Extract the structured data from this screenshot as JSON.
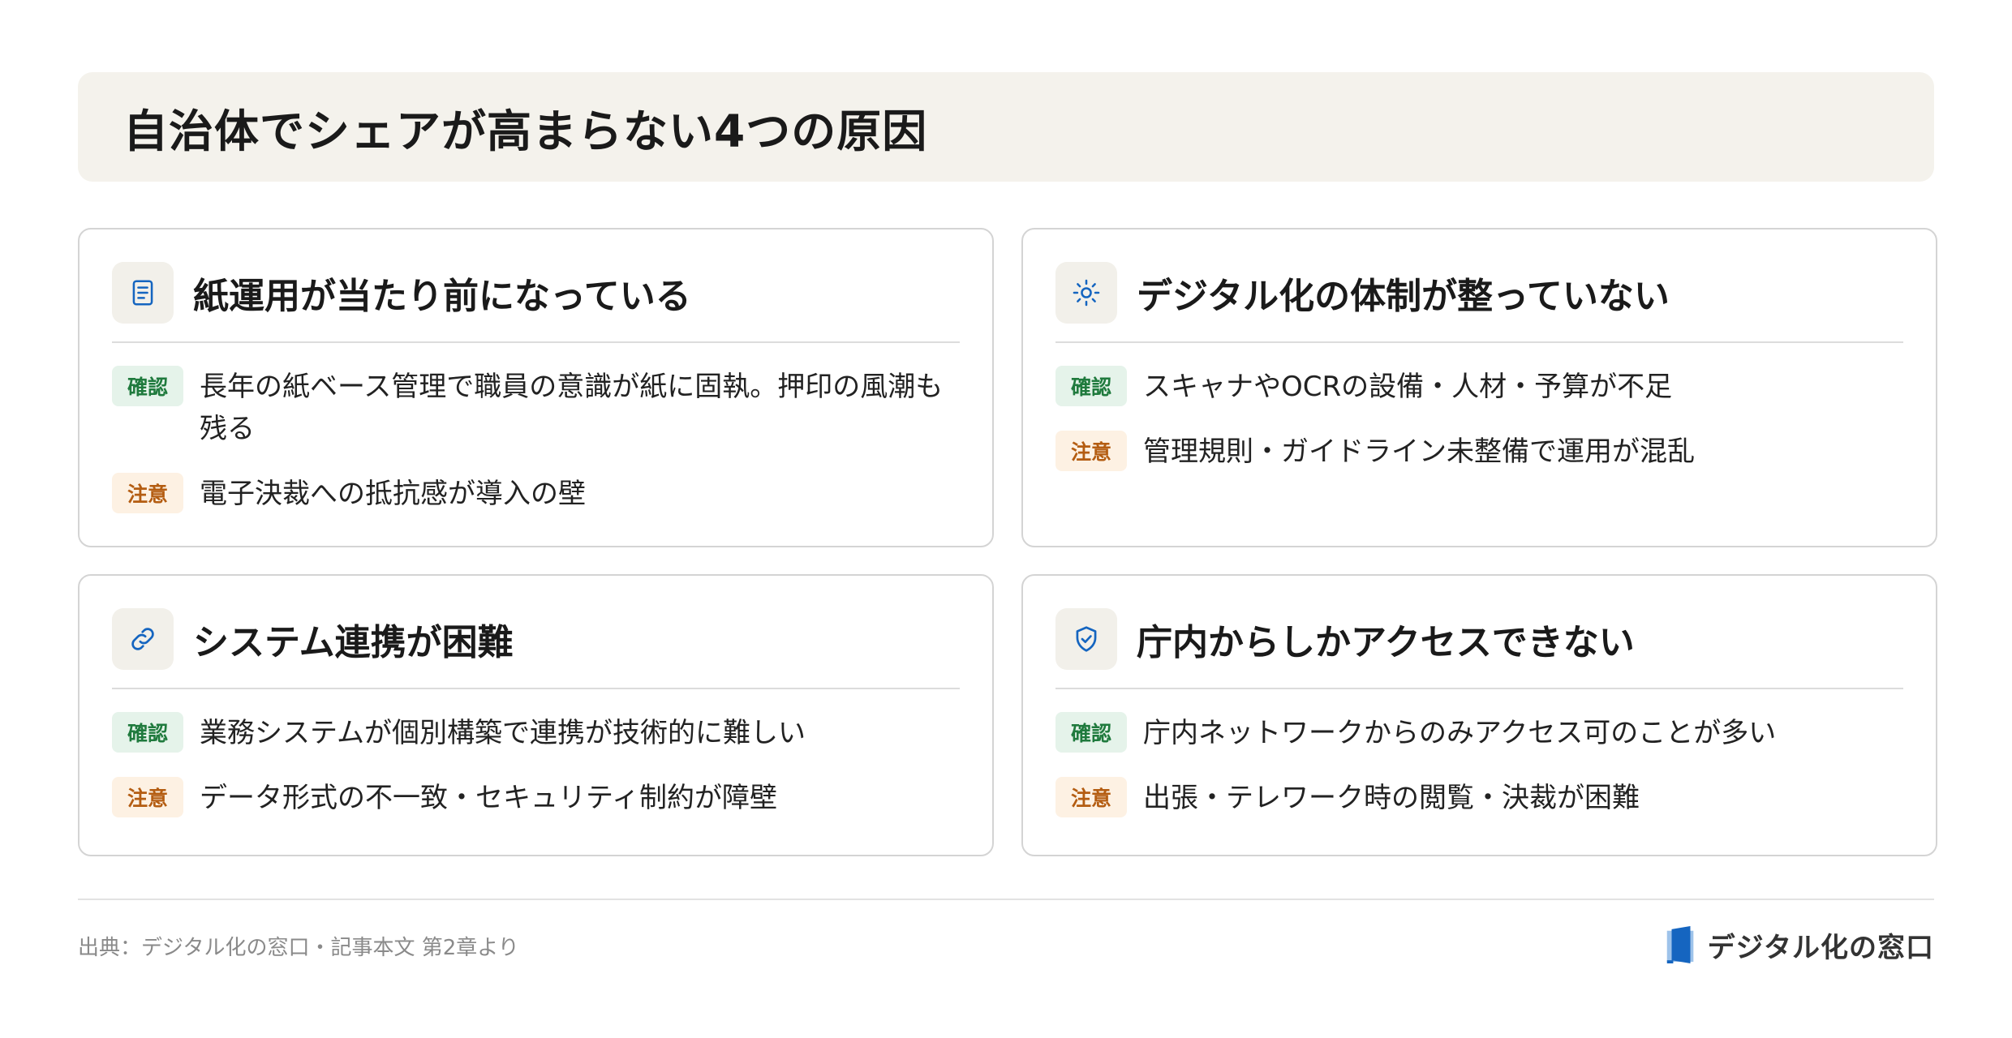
{
  "title": "自治体でシェアが高まらない4つの原因",
  "cards": [
    {
      "icon": "document-icon",
      "title": "紙運用が当たり前になっている",
      "rows": [
        {
          "tag": "確認",
          "text": "長年の紙ベース管理で職員の意識が紙に固執。押印の風潮も残る"
        },
        {
          "tag": "注意",
          "text": "電子決裁への抵抗感が導入の壁"
        }
      ]
    },
    {
      "icon": "sun-icon",
      "title": "デジタル化の体制が整っていない",
      "rows": [
        {
          "tag": "確認",
          "text": "スキャナやOCRの設備・人材・予算が不足"
        },
        {
          "tag": "注意",
          "text": "管理規則・ガイドライン未整備で運用が混乱"
        }
      ]
    },
    {
      "icon": "link-icon",
      "title": "システム連携が困難",
      "rows": [
        {
          "tag": "確認",
          "text": "業務システムが個別構築で連携が技術的に難しい"
        },
        {
          "tag": "注意",
          "text": "データ形式の不一致・セキュリティ制約が障壁"
        }
      ]
    },
    {
      "icon": "shield-check-icon",
      "title": "庁内からしかアクセスできない",
      "rows": [
        {
          "tag": "確認",
          "text": "庁内ネットワークからのみアクセス可のことが多い"
        },
        {
          "tag": "注意",
          "text": "出張・テレワーク時の閲覧・決裁が困難"
        }
      ]
    }
  ],
  "footer": {
    "source": "出典：デジタル化の窓口・記事本文 第2章より",
    "brand": "デジタル化の窓口",
    "brand_icon": "door-logo-icon"
  },
  "colors": {
    "accent_blue": "#1565c0",
    "confirm_text": "#1f7a3d",
    "confirm_bg": "#e5f3ea",
    "caution_text": "#b45d12",
    "caution_bg": "#fdf1e3",
    "title_bg": "#f4f2ec"
  }
}
